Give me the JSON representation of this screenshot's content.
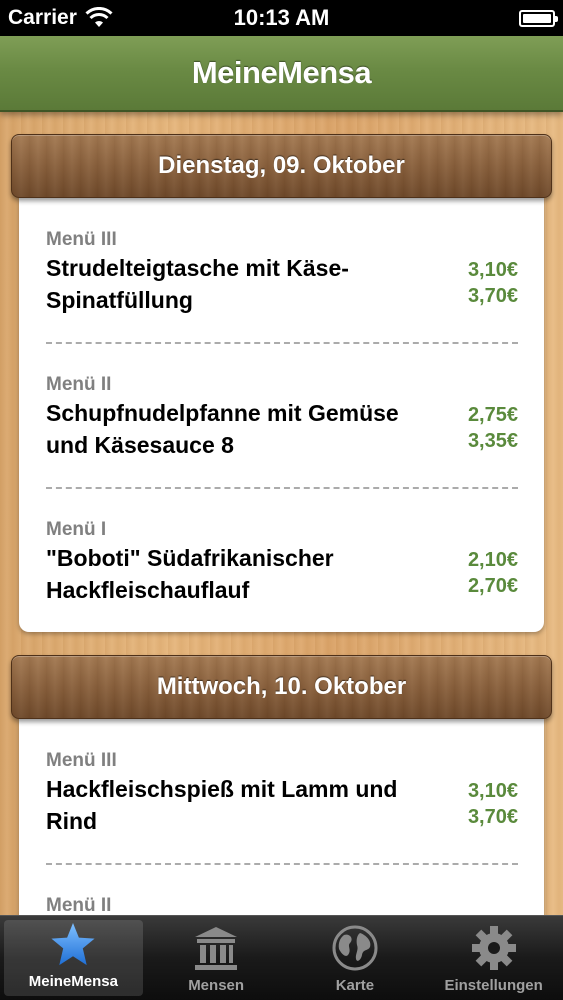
{
  "status_bar": {
    "carrier": "Carrier",
    "time": "10:13 AM"
  },
  "nav": {
    "title": "MeineMensa"
  },
  "days": [
    {
      "title": "Dienstag, 09. Oktober",
      "items": [
        {
          "label": "Menü III",
          "name": "Strudelteigtasche mit Käse-Spinatfüllung",
          "prices": [
            "3,10€",
            "3,70€"
          ]
        },
        {
          "label": "Menü II",
          "name": "Schupfnudelpfanne mit Gemüse und Käsesauce 8",
          "prices": [
            "2,75€",
            "3,35€"
          ]
        },
        {
          "label": "Menü I",
          "name": "\"Boboti\" Südafrikanischer Hackfleischauflauf",
          "prices": [
            "2,10€",
            "2,70€"
          ]
        }
      ]
    },
    {
      "title": "Mittwoch, 10. Oktober",
      "items": [
        {
          "label": "Menü III",
          "name": "Hackfleischspieß mit Lamm und Rind",
          "prices": [
            "3,10€",
            "3,70€"
          ]
        },
        {
          "label": "Menü II",
          "name": "",
          "prices": []
        }
      ]
    }
  ],
  "tabs": [
    {
      "label": "MeineMensa",
      "icon": "star-icon",
      "active": true
    },
    {
      "label": "Mensen",
      "icon": "building-icon",
      "active": false
    },
    {
      "label": "Karte",
      "icon": "globe-icon",
      "active": false
    },
    {
      "label": "Einstellungen",
      "icon": "gear-icon",
      "active": false
    }
  ],
  "colors": {
    "nav_green": "#6a8a44",
    "price_green": "#5a8a3c",
    "header_wood": "#8a613d",
    "tab_active_icon": "#2f7fe0"
  }
}
